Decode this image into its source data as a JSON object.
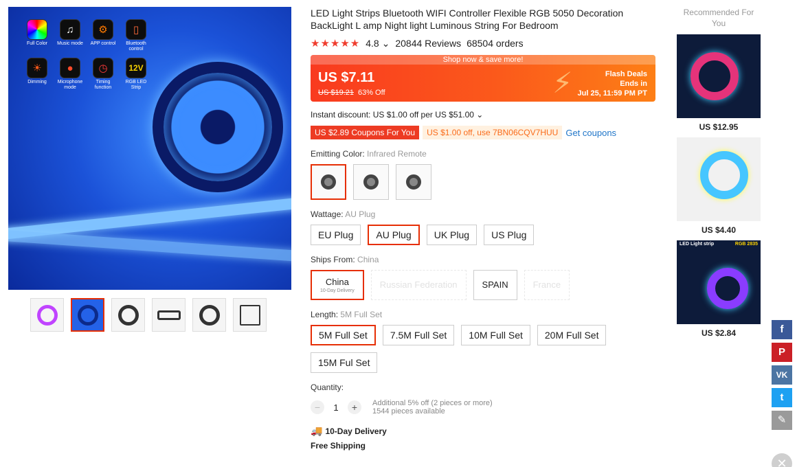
{
  "gallery": {
    "features": [
      {
        "label": "Full Color",
        "icon": "rainbow-ring-icon"
      },
      {
        "label": "Music mode",
        "icon": "music-note-icon"
      },
      {
        "label": "APP control",
        "icon": "app-icon"
      },
      {
        "label": "Bluetooth control",
        "icon": "phone-icon"
      },
      {
        "label": "Dimming",
        "icon": "sun-icon"
      },
      {
        "label": "Microphone mode",
        "icon": "microphone-icon"
      },
      {
        "label": "Timing function",
        "icon": "clock-icon"
      },
      {
        "label": "RGB LED Strip",
        "icon": "12v-badge-icon",
        "badge": "12V"
      }
    ]
  },
  "product": {
    "title": "LED Light Strips Bluetooth WIFI Controller Flexible RGB 5050 Decoration BackLight L amp Night light Luminous String For Bedroom",
    "stars": "★★★★★",
    "rating": "4.8",
    "reviews": "20844 Reviews",
    "orders": "68504 orders"
  },
  "price": {
    "banner": "Shop now & save more!",
    "current": "US $7.11",
    "original": "US $19.21",
    "discount": "63% Off",
    "flash_title": "Flash Deals",
    "flash_ends": "Ends in",
    "flash_date": "Jul 25, 11:59 PM PT"
  },
  "discounts": {
    "instant": "Instant discount: US $1.00 off per US $51.00 ⌄",
    "coupon_store": "US $2.89 Coupons For You",
    "coupon_code": "US $1.00 off, use 7BN06CQV7HUU",
    "get_coupons": "Get coupons"
  },
  "props": {
    "color_label": "Emitting Color:",
    "color_value": "Infrared Remote",
    "wattage_label": "Wattage:",
    "wattage_value": "AU Plug",
    "wattage_options": [
      "EU Plug",
      "AU Plug",
      "UK Plug",
      "US Plug"
    ],
    "ships_label": "Ships From:",
    "ships_value": "China",
    "ships_china_sub": "10-Day Delivery",
    "ships_options": [
      "China",
      "Russian Federation",
      "SPAIN",
      "France"
    ],
    "length_label": "Length:",
    "length_value": "5M Full Set",
    "length_options": [
      "5M Full Set",
      "7.5M Full Set",
      "10M Full Set",
      "20M Full Set",
      "15M Ful Set"
    ]
  },
  "quantity": {
    "label": "Quantity:",
    "minus": "−",
    "value": "1",
    "plus": "+",
    "note1": "Additional 5% off (2 pieces or more)",
    "note2": "1544 pieces available"
  },
  "shipping": {
    "delivery": "10-Day Delivery",
    "free": "Free Shipping"
  },
  "recommended": {
    "title": "Recommended For You",
    "items": [
      {
        "price": "US $12.95"
      },
      {
        "price": "US $4.40"
      },
      {
        "price": "US $2.84",
        "img_label_left": "LED Light strip",
        "img_label_right": "RGB 2835"
      }
    ]
  },
  "share": {
    "facebook": "f",
    "pinterest": "P",
    "vk": "VK",
    "twitter": "t",
    "edit": "✎",
    "close": "✕"
  }
}
